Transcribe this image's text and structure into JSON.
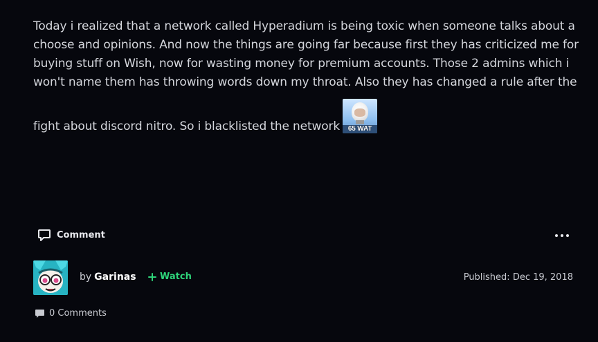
{
  "journal": {
    "lines": [
      "Today i realized that a network called Hyperadium is being toxic when someone talks about a",
      "choose and opinions. And now the things are going far because first they has criticized me for",
      "buying stuff on Wish, now for wasting money for premium accounts. Those 2 admins which i",
      "won't name them has throwing words down my throat. Also they has changed a rule after the"
    ],
    "last_line": "fight about discord nitro. So i blacklisted the network",
    "emoji_caption": "65 WAT"
  },
  "actions": {
    "comment_label": "Comment",
    "more_icon": "more-horizontal-icon"
  },
  "author": {
    "by_label": "by",
    "name": "Garinas",
    "watch_label": "Watch",
    "avatar_icon": "avatar"
  },
  "published": {
    "label": "Published:",
    "date": "Dec 19, 2018"
  },
  "comments": {
    "count_label": "0 Comments"
  },
  "colors": {
    "background": "#06070d",
    "text": "#d4d6dc",
    "watch_accent": "#2ed47a"
  }
}
